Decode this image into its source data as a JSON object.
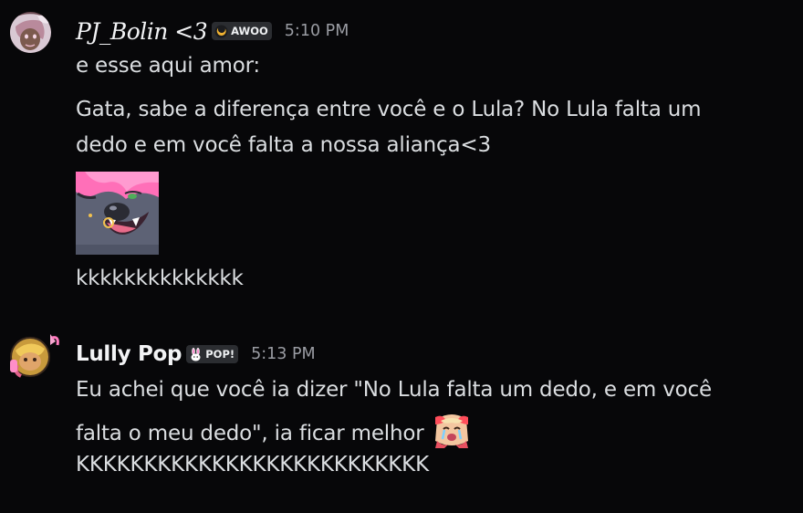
{
  "messages": [
    {
      "author": "PJ_Bolin <3",
      "tag": "AWOO",
      "timestamp": "5:10 PM",
      "lines": [
        "e esse aqui amor:",
        "Gata, sabe a diferença entre você e o Lula? No Lula falta um",
        "dedo e em você falta a nossa aliança<3"
      ],
      "after_sticker": "kkkkkkkkkkkkkk"
    },
    {
      "author": "Lully Pop",
      "tag": "POP!",
      "timestamp": "5:13 PM",
      "lines": [
        "Eu achei que você ia dizer \"No Lula falta um dedo, e em você",
        "falta o meu dedo\", ia ficar melhor",
        "KKKKKKKKKKKKKKKKKKKKKKKKKK"
      ]
    }
  ],
  "colors": {
    "background": "#070709",
    "text": "#dbdee1",
    "username": "#f2f3f5",
    "timestamp": "#9a9ca3",
    "tag_bg": "#2b2d31",
    "tag_icon_awoo": "#f0b232",
    "tag_icon_pop": "#ff73c6"
  },
  "icons": {
    "awoo_tag": "crescent-moon-icon",
    "pop_tag": "bunny-icon",
    "emoji": "crying-face-emoji",
    "sticker": "wolf-face-sticker"
  }
}
